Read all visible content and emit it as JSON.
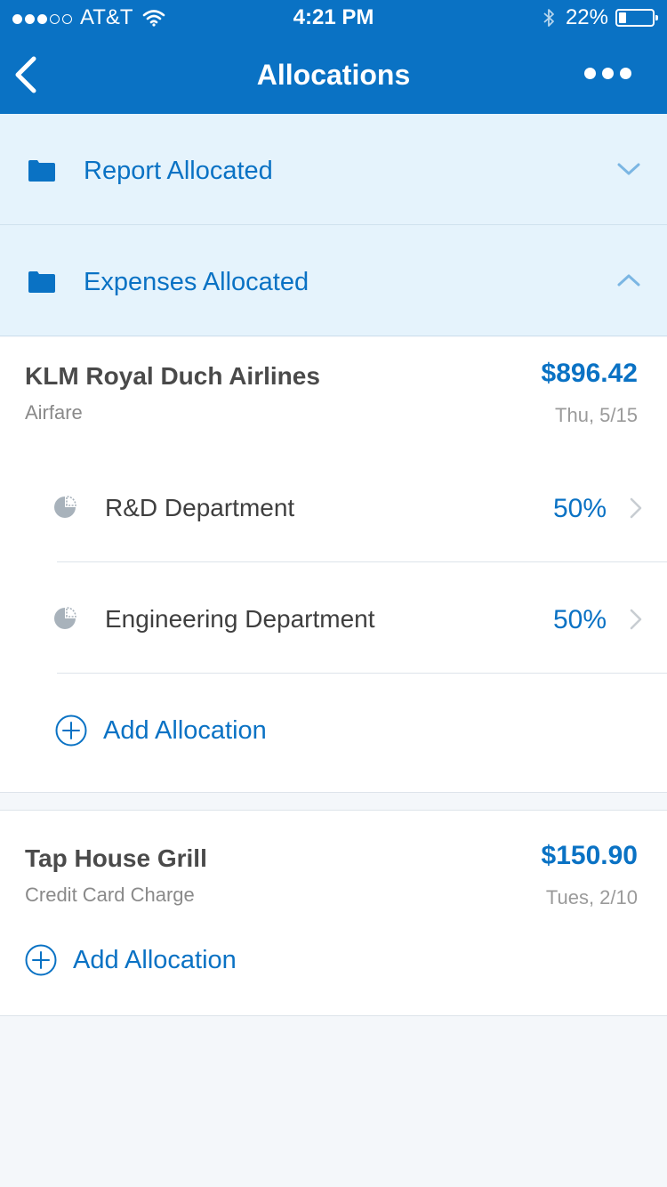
{
  "status_bar": {
    "signal_dots": [
      true,
      true,
      true,
      false,
      false
    ],
    "carrier": "AT&T",
    "time": "4:21 PM",
    "battery": "22%",
    "battery_level": 0.22,
    "icons": [
      "wifi-icon",
      "bluetooth-icon",
      "battery-icon"
    ]
  },
  "nav": {
    "title": "Allocations",
    "back_icon": "chevron-left-icon",
    "more_icon": "more-dots-icon"
  },
  "sections": [
    {
      "label": "Report Allocated",
      "icon": "folder-icon",
      "chevron": "chevron-down-icon",
      "expanded": false
    },
    {
      "label": "Expenses Allocated",
      "icon": "folder-icon",
      "chevron": "chevron-up-icon",
      "expanded": true
    }
  ],
  "expenses": [
    {
      "merchant": "KLM Royal Duch Airlines",
      "category": "Airfare",
      "amount": "$896.42",
      "date": "Thu, 5/15",
      "allocations": [
        {
          "department": "R&D Department",
          "percent": "50%",
          "icon": "pie-chart-icon"
        },
        {
          "department": "Engineering Department",
          "percent": "50%",
          "icon": "pie-chart-icon"
        }
      ],
      "add_label": "Add Allocation"
    },
    {
      "merchant": "Tap House Grill",
      "category": "Credit Card Charge",
      "amount": "$150.90",
      "date": "Tues, 2/10",
      "allocations": [],
      "add_label": "Add Allocation"
    }
  ],
  "colors": {
    "brand": "#0a72c4",
    "section_bg": "#e5f3fc",
    "page_bg": "#f4f7fa"
  }
}
